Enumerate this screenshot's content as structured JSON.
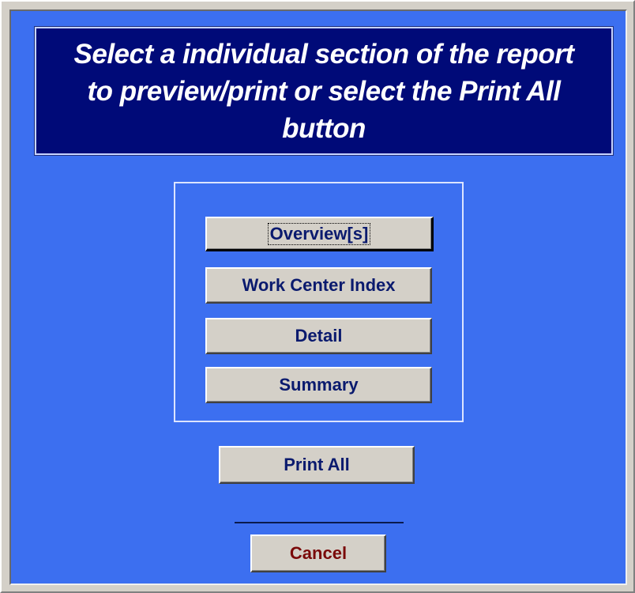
{
  "header": {
    "text": "Select a individual section of the report to preview/print or select the Print All button"
  },
  "sections": {
    "overview_label": "Overview[s]",
    "work_center_label": "Work Center Index",
    "detail_label": "Detail",
    "summary_label": "Summary"
  },
  "actions": {
    "print_all_label": "Print All",
    "cancel_label": "Cancel"
  },
  "colors": {
    "form_background": "#3c6ff0",
    "banner_background": "#000a78",
    "button_face": "#d4d0c8",
    "button_text": "#0a1a6e",
    "cancel_text": "#7a0a0a"
  }
}
